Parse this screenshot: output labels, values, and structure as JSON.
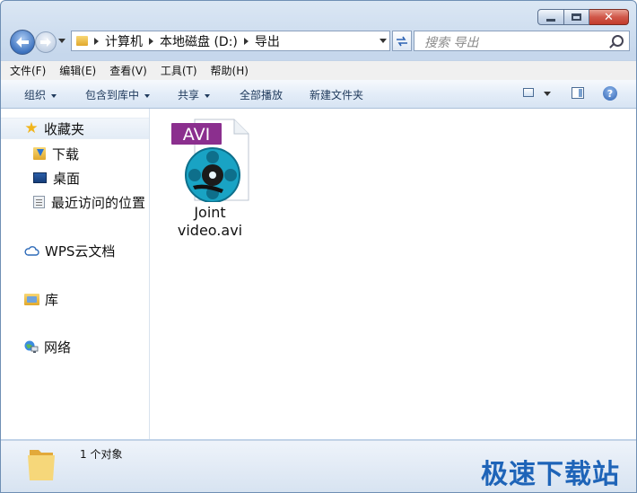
{
  "window": {
    "caption_buttons": {
      "minimize": "",
      "maximize": "",
      "close": "✕"
    }
  },
  "nav": {
    "breadcrumbs": [
      "计算机",
      "本地磁盘 (D:)",
      "导出"
    ],
    "search_placeholder": "搜索 导出",
    "refresh_icon": "refresh-icon"
  },
  "menubar": {
    "items": [
      "文件(F)",
      "编辑(E)",
      "查看(V)",
      "工具(T)",
      "帮助(H)"
    ]
  },
  "toolbar": {
    "organize": "组织",
    "include_library": "包含到库中",
    "share": "共享",
    "play_all": "全部播放",
    "new_folder": "新建文件夹",
    "help": "?"
  },
  "sidebar": {
    "favorites": {
      "label": "收藏夹",
      "icon": "star-icon"
    },
    "favorite_items": [
      {
        "label": "下载",
        "icon": "downloads-icon"
      },
      {
        "label": "桌面",
        "icon": "desktop-icon"
      },
      {
        "label": "最近访问的位置",
        "icon": "recent-places-icon"
      }
    ],
    "wps": {
      "label": "WPS云文档",
      "icon": "cloud-icon"
    },
    "libraries": {
      "label": "库",
      "icon": "library-icon"
    },
    "network": {
      "label": "网络",
      "icon": "network-icon"
    }
  },
  "content": {
    "files": [
      {
        "badge": "AVI",
        "name_line1": "Joint",
        "name_line2": "video.avi"
      }
    ]
  },
  "status": {
    "count": "1 个对象",
    "watermark": "极速下载站"
  },
  "colors": {
    "avi_badge": "#8b2f8e",
    "reel_teal": "#19a3c4",
    "watermark": "#1e64b8"
  }
}
